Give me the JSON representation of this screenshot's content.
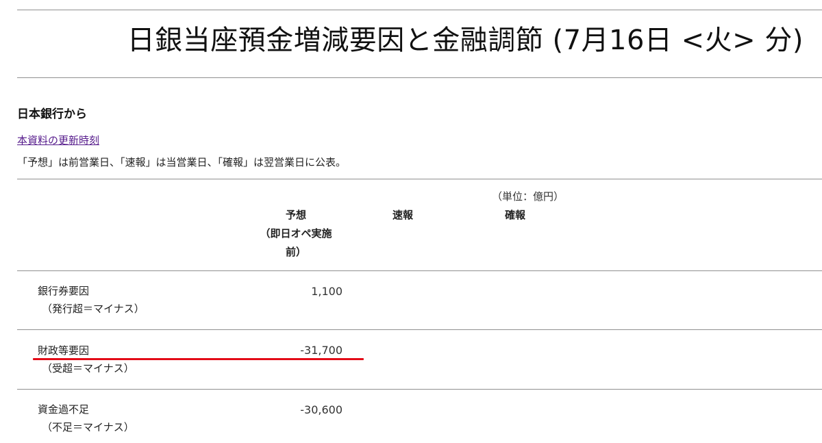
{
  "header": {
    "title": "日銀当座預金増減要因と金融調節 (7月16日 <火> 分)"
  },
  "source": {
    "heading": "日本銀行から",
    "update_link": "本資料の更新時刻",
    "note": "「予想」は前営業日、「速報」は当営業日、「確報」は翌営業日に公表。"
  },
  "table": {
    "unit": "（単位：億円）",
    "columns": {
      "yosou_line1": "予想",
      "yosou_line2": "（即日オペ実施",
      "yosou_line3": "前）",
      "sokuhou": "速報",
      "kakuhou": "確報"
    },
    "rows": [
      {
        "label": "銀行券要因",
        "sublabel": "（発行超＝マイナス）",
        "yosou": "1,100",
        "sokuhou": "",
        "kakuhou": ""
      },
      {
        "label": "財政等要因",
        "sublabel": "（受超＝マイナス）",
        "yosou": "-31,700",
        "sokuhou": "",
        "kakuhou": ""
      },
      {
        "label": "資金過不足",
        "sublabel": "（不足＝マイナス）",
        "yosou": "-30,600",
        "sokuhou": "",
        "kakuhou": ""
      }
    ]
  },
  "annotation": {
    "highlight_color": "#e30b17"
  }
}
